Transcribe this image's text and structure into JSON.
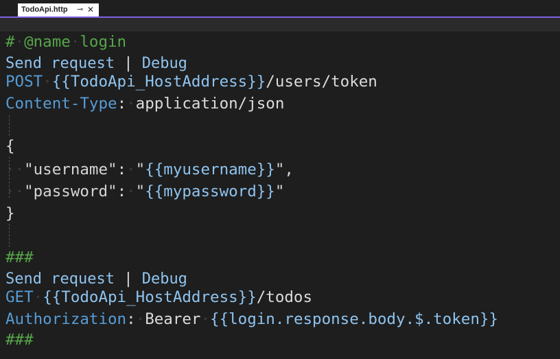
{
  "tab": {
    "title": "TodoApi.http",
    "pin_glyph": "⊸",
    "close_glyph": "✕"
  },
  "colors": {
    "accent": "#7f62e8",
    "comment": "#57a64a",
    "keyword": "#569cd6",
    "variable": "#8fc4f0",
    "text": "#dcdcdc",
    "background": "#1e1e1e"
  },
  "code": {
    "l1": {
      "hash": "#",
      "rest": "@name",
      "name": "login"
    },
    "codelens1": {
      "send": "Send request",
      "sep": "|",
      "debug": "Debug"
    },
    "l3": {
      "method": "POST",
      "var": "{{TodoApi_HostAddress}}",
      "path": "/users/token"
    },
    "l4": {
      "header": "Content-Type",
      "colon": ":",
      "value": "application/json"
    },
    "l6": {
      "brace": "{"
    },
    "l7": {
      "key": "\"username\"",
      "colon": ":",
      "q1": "\"",
      "var": "{{myusername}}",
      "q2": "\",",
      "indent": "··"
    },
    "l8": {
      "key": "\"password\"",
      "colon": ":",
      "q1": "\"",
      "var": "{{mypassword}}",
      "q2": "\"",
      "indent": "··"
    },
    "l9": {
      "brace": "}"
    },
    "l11": {
      "sep": "###"
    },
    "codelens2": {
      "send": "Send request",
      "sep": "|",
      "debug": "Debug"
    },
    "l13": {
      "method": "GET",
      "var": "{{TodoApi_HostAddress}}",
      "path": "/todos"
    },
    "l14": {
      "header": "Authorization",
      "colon": ":",
      "scheme": "Bearer",
      "var": "{{login.response.body.$.token}}"
    },
    "l15": {
      "sep": "###"
    }
  }
}
